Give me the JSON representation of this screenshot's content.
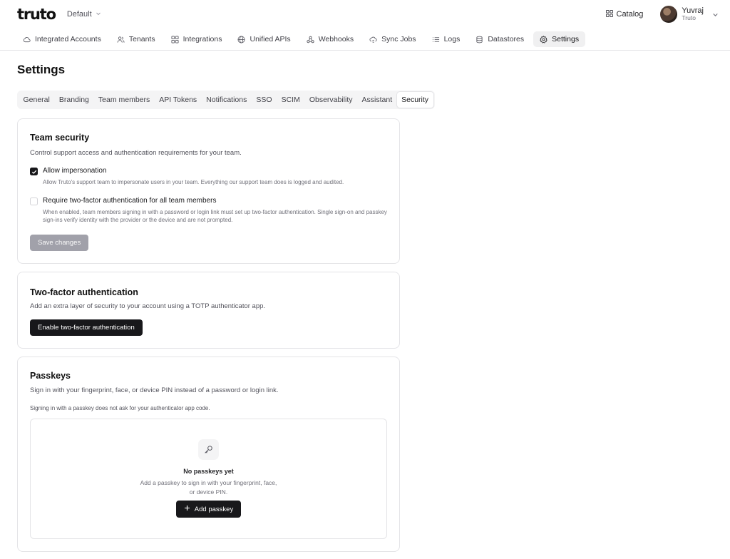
{
  "app": {
    "logo": "truto",
    "workspace": "Default"
  },
  "header": {
    "catalog_label": "Catalog",
    "user": {
      "name": "Yuvraj",
      "org": "Truto"
    }
  },
  "nav": {
    "items": [
      {
        "label": "Integrated Accounts",
        "icon": "cloud-icon"
      },
      {
        "label": "Tenants",
        "icon": "users-icon"
      },
      {
        "label": "Integrations",
        "icon": "grid-icon"
      },
      {
        "label": "Unified APIs",
        "icon": "globe-icon"
      },
      {
        "label": "Webhooks",
        "icon": "webhook-icon"
      },
      {
        "label": "Sync Jobs",
        "icon": "cloud-sync-icon"
      },
      {
        "label": "Logs",
        "icon": "list-icon"
      },
      {
        "label": "Datastores",
        "icon": "database-icon"
      },
      {
        "label": "Settings",
        "icon": "gear-icon"
      }
    ],
    "active": "Settings"
  },
  "page": {
    "title": "Settings",
    "tabs": [
      "General",
      "Branding",
      "Team members",
      "API Tokens",
      "Notifications",
      "SSO",
      "SCIM",
      "Observability",
      "Assistant",
      "Security"
    ],
    "active_tab": "Security"
  },
  "team_security": {
    "title": "Team security",
    "description": "Control support access and authentication requirements for your team.",
    "impersonation": {
      "label": "Allow impersonation",
      "checked": true,
      "help": "Allow Truto's support team to impersonate users in your team. Everything our support team does is logged and audited."
    },
    "require_2fa": {
      "label": "Require two-factor authentication for all team members",
      "checked": false,
      "help": "When enabled, team members signing in with a password or login link must set up two-factor authentication. Single sign-on and passkey sign-ins verify identity with the provider or the device and are not prompted."
    },
    "save_label": "Save changes"
  },
  "two_factor": {
    "title": "Two-factor authentication",
    "description": "Add an extra layer of security to your account using a TOTP authenticator app.",
    "button_label": "Enable two-factor authentication"
  },
  "passkeys": {
    "title": "Passkeys",
    "description": "Sign in with your fingerprint, face, or device PIN instead of a password or login link.",
    "note": "Signing in with a passkey does not ask for your authenticator app code.",
    "empty_title": "No passkeys yet",
    "empty_description": "Add a passkey to sign in with your fingerprint, face, or device PIN.",
    "add_label": "Add passkey"
  }
}
